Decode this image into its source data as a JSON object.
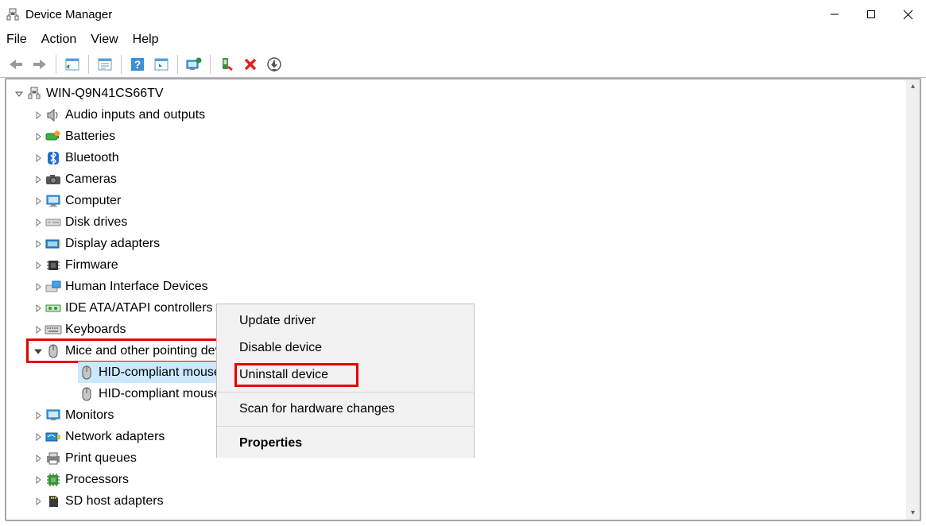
{
  "window": {
    "title": "Device Manager"
  },
  "menu": {
    "file": "File",
    "action": "Action",
    "view": "View",
    "help": "Help"
  },
  "tree": {
    "root": "WIN-Q9N41CS66TV",
    "audio": "Audio inputs and outputs",
    "batteries": "Batteries",
    "bluetooth": "Bluetooth",
    "cameras": "Cameras",
    "computer": "Computer",
    "disk": "Disk drives",
    "display": "Display adapters",
    "firmware": "Firmware",
    "hid": "Human Interface Devices",
    "ide": "IDE ATA/ATAPI controllers",
    "keyboards": "Keyboards",
    "mice": "Mice and other pointing devices",
    "mouse1": "HID-compliant mouse",
    "mouse2": "HID-compliant mouse",
    "monitors": "Monitors",
    "network": "Network adapters",
    "printq": "Print queues",
    "processors": "Processors",
    "sdhost": "SD host adapters"
  },
  "context_menu": {
    "update": "Update driver",
    "disable": "Disable device",
    "uninstall": "Uninstall device",
    "scan": "Scan for hardware changes",
    "properties": "Properties"
  }
}
